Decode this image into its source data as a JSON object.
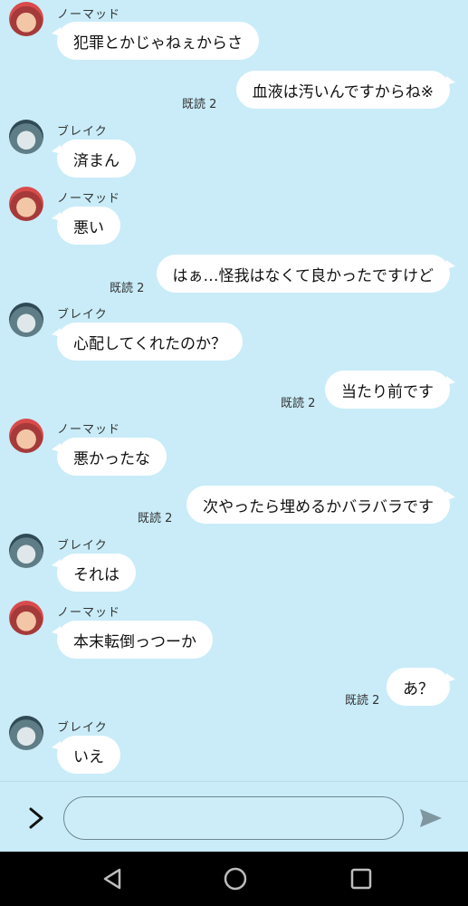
{
  "messages": [
    {
      "side": "left",
      "speaker": "ノーマッド",
      "avatar": "nomad-avatar",
      "text": "犯罪とかじゃねぇからさ"
    },
    {
      "side": "right",
      "read": "既読 2",
      "text": "血液は汚いんですからね※"
    },
    {
      "side": "left",
      "speaker": "ブレイク",
      "avatar": "blake-avatar",
      "text": "済まん"
    },
    {
      "side": "left",
      "speaker": "ノーマッド",
      "avatar": "nomad-avatar",
      "text": "悪い"
    },
    {
      "side": "right",
      "read": "既読 2",
      "text": "はぁ…怪我はなくて良かったですけど"
    },
    {
      "side": "left",
      "speaker": "ブレイク",
      "avatar": "blake-avatar",
      "text": "心配してくれたのか？"
    },
    {
      "side": "right",
      "read": "既読 2",
      "text": "当たり前です"
    },
    {
      "side": "left",
      "speaker": "ノーマッド",
      "avatar": "nomad-avatar",
      "text": "悪かったな"
    },
    {
      "side": "right",
      "read": "既読 2",
      "text": "次やったら埋めるかバラバラです"
    },
    {
      "side": "left",
      "speaker": "ブレイク",
      "avatar": "blake-avatar",
      "text": "それは"
    },
    {
      "side": "left",
      "speaker": "ノーマッド",
      "avatar": "nomad-avatar",
      "text": "本末転倒っつーか"
    },
    {
      "side": "right",
      "read": "既読 2",
      "text": "あ？"
    },
    {
      "side": "left",
      "speaker": "ブレイク",
      "avatar": "blake-avatar",
      "text": "いえ"
    }
  ],
  "input": {
    "value": "",
    "placeholder": ""
  },
  "icons": {
    "expand": "chevron-right-icon",
    "send": "send-icon",
    "nav_back": "back-triangle-icon",
    "nav_home": "home-circle-icon",
    "nav_recent": "recent-square-icon"
  },
  "colors": {
    "background": "#c9ecf8",
    "bubble": "#ffffff",
    "navbar": "#000000",
    "send": "#7f96a0"
  }
}
